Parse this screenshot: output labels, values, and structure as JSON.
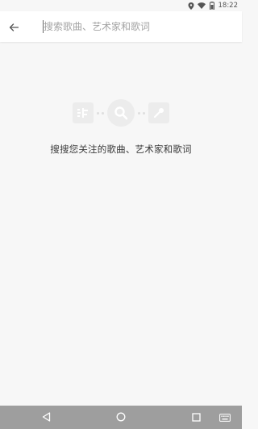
{
  "status_bar": {
    "time": "18:22",
    "icons": [
      "location-icon",
      "wifi-icon",
      "battery-icon"
    ]
  },
  "search": {
    "placeholder": "搜索歌曲、艺术家和歌词",
    "value": ""
  },
  "empty_state": {
    "message": "搜搜您关注的歌曲、艺术家和歌词",
    "icons": [
      "lyrics-icon",
      "search-icon",
      "microphone-icon"
    ]
  },
  "nav_bar": {
    "buttons": [
      "back-icon",
      "home-icon",
      "recents-icon",
      "keyboard-icon"
    ]
  },
  "colors": {
    "background": "#f7f7f7",
    "header": "#ffffff",
    "nav_bar": "#9e9e9e",
    "illustration": "#ececec"
  }
}
